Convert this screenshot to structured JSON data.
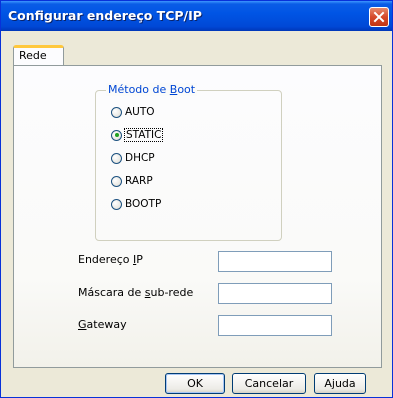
{
  "window": {
    "title": "Configurar endereço TCP/IP"
  },
  "tabs": [
    {
      "label": "Rede",
      "active": true
    }
  ],
  "boot_method": {
    "legend": "Método de Boot",
    "options": [
      {
        "label": "AUTO",
        "selected": false
      },
      {
        "label": "STATIC",
        "selected": true
      },
      {
        "label": "DHCP",
        "selected": false
      },
      {
        "label": "RARP",
        "selected": false
      },
      {
        "label": "BOOTP",
        "selected": false
      }
    ]
  },
  "fields": {
    "ip": {
      "label": "Endereço IP",
      "value": ""
    },
    "subnet": {
      "label": "Máscara de sub-rede",
      "value": ""
    },
    "gateway": {
      "label": "Gateway",
      "value": ""
    }
  },
  "buttons": {
    "ok": "OK",
    "cancel": "Cancelar",
    "help": "Ajuda"
  },
  "colors": {
    "title_bar": "#0055e5",
    "close_button": "#d6492a",
    "group_legend": "#0046d5",
    "tab_highlight": "#ffc83c"
  },
  "icons": {
    "close": "close-icon"
  }
}
